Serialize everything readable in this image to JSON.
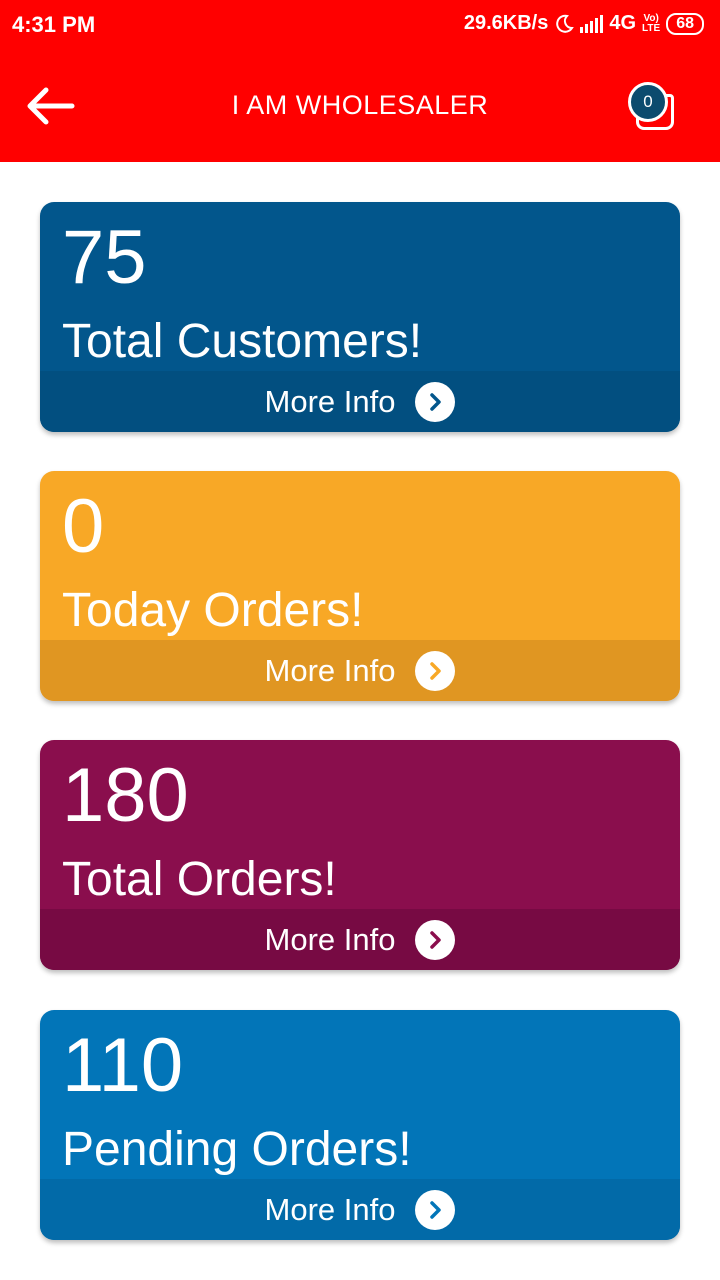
{
  "status_bar": {
    "time": "4:31 PM",
    "network_speed": "29.6KB/s",
    "network_type": "4G",
    "volte_top": "Vo)",
    "volte_bottom": "LTE",
    "battery": "68",
    "icons": [
      "moon-icon",
      "signal-icon",
      "volte-icon",
      "battery-icon"
    ]
  },
  "app_bar": {
    "title": "I AM WHOLESALER",
    "back_icon": "arrow-left-icon",
    "cart_icon": "shopping-bag-icon",
    "cart_count": "0",
    "background": "#ff0000",
    "badge_color": "#0c4b6e"
  },
  "cards": [
    {
      "value": "75",
      "label": "Total Customers!",
      "more": "More Info",
      "color": "#02568c",
      "footer_color": "#024f80",
      "arrow_icon": "chevron-right-icon"
    },
    {
      "value": "0",
      "label": "Today Orders!",
      "more": "More Info",
      "color": "#f8a826",
      "footer_color": "#e09622",
      "arrow_icon": "chevron-right-icon"
    },
    {
      "value": "180",
      "label": "Total Orders!",
      "more": "More Info",
      "color": "#8a0e4d",
      "footer_color": "#770a43",
      "arrow_icon": "chevron-right-icon"
    },
    {
      "value": "110",
      "label": "Pending Orders!",
      "more": "More Info",
      "color": "#0275b8",
      "footer_color": "#026aa8",
      "arrow_icon": "chevron-right-icon"
    }
  ]
}
